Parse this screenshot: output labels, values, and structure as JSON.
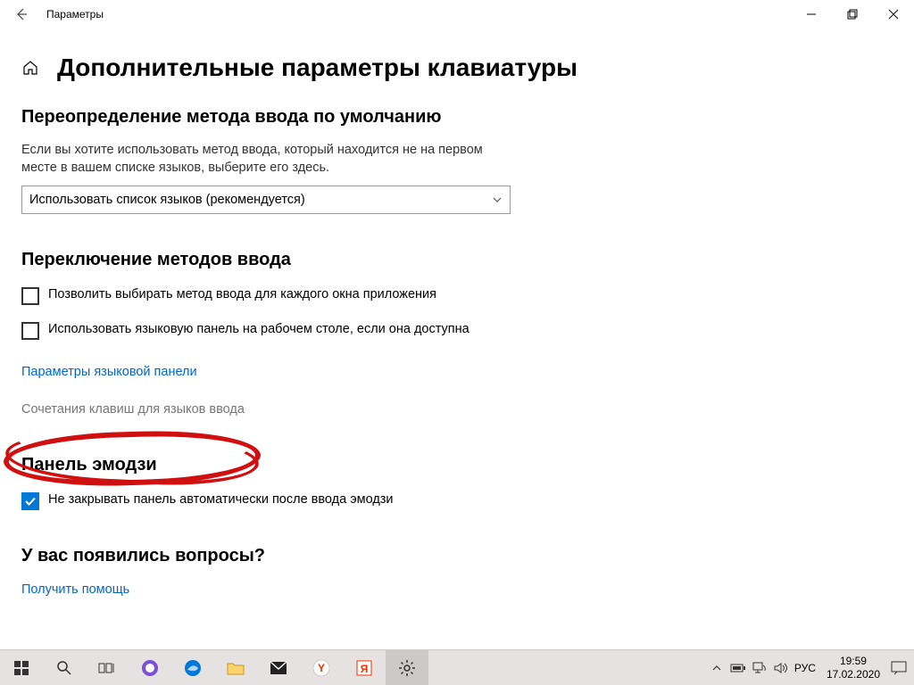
{
  "titlebar": {
    "title": "Параметры"
  },
  "page": {
    "title": "Дополнительные параметры клавиатуры"
  },
  "section1": {
    "title": "Переопределение метода ввода по умолчанию",
    "desc": "Если вы хотите использовать метод ввода, который находится не на первом месте в вашем списке языков, выберите его здесь.",
    "dropdown": "Использовать список языков (рекомендуется)"
  },
  "section2": {
    "title": "Переключение методов ввода",
    "cb1": "Позволить выбирать метод ввода для каждого окна приложения",
    "cb2": "Использовать языковую панель на рабочем столе, если она доступна",
    "link1": "Параметры языковой панели",
    "link2": "Сочетания клавиш для языков ввода"
  },
  "section3": {
    "title": "Панель эмодзи",
    "cb1": "Не закрывать панель автоматически после ввода эмодзи"
  },
  "section4": {
    "title": "У вас появились вопросы?",
    "link": "Получить помощь"
  },
  "tray": {
    "lang": "РУС",
    "time": "19:59",
    "date": "17.02.2020"
  }
}
